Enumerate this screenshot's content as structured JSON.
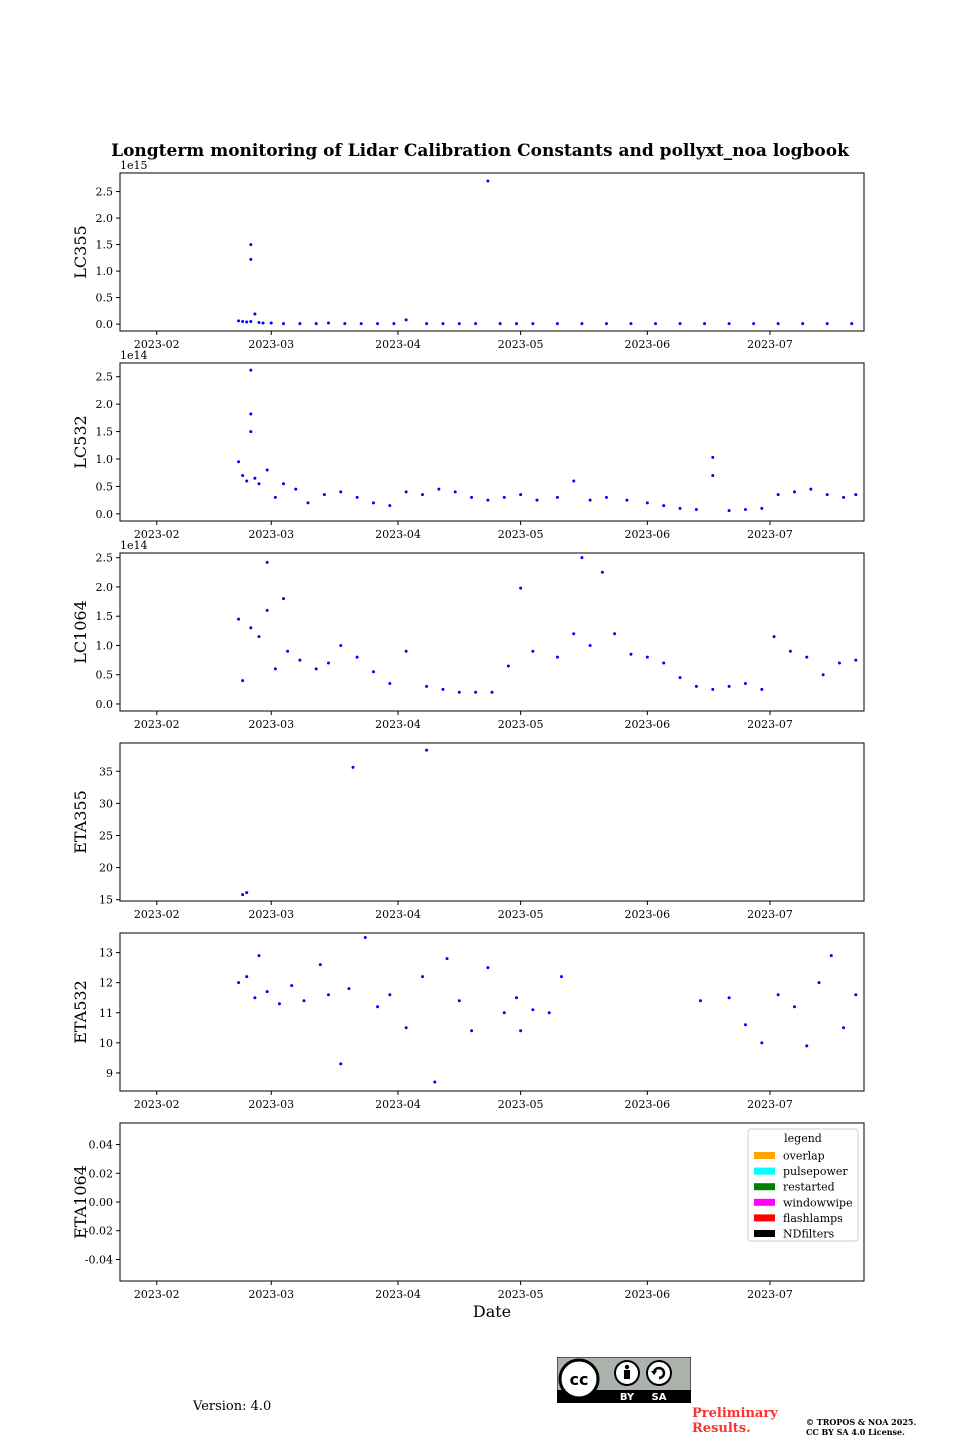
{
  "figure": {
    "title": "Longterm monitoring of Lidar Calibration Constants and pollyxt_noa logbook",
    "version": "Version: 4.0",
    "preliminary_line1": "Preliminary",
    "preliminary_line2": "Results.",
    "copyright_line1": "© TROPOS & NOA 2025.",
    "copyright_line2": "CC BY SA 4.0 License.",
    "license_badge": {
      "icons": [
        "cc-icon",
        "by-icon",
        "sa-icon"
      ],
      "by": "BY",
      "sa": "SA"
    }
  },
  "chart_data": [
    {
      "type": "scatter",
      "ylabel": "LC355",
      "xlabel": "",
      "offset_text": "1e15",
      "ylim": [
        -0.13,
        2.85
      ],
      "yticks": [
        0.0,
        0.5,
        1.0,
        1.5,
        2.0,
        2.5
      ],
      "ytick_decimals": 1,
      "xlim": [
        "2023-01-23",
        "2023-07-24"
      ],
      "xticks": [
        "2023-02",
        "2023-03",
        "2023-04",
        "2023-05",
        "2023-06",
        "2023-07"
      ],
      "xtick_dates": [
        "2023-02-01",
        "2023-03-01",
        "2023-04-01",
        "2023-05-01",
        "2023-06-01",
        "2023-07-01"
      ],
      "grid": false,
      "point_color": "#0000ff",
      "points": [
        [
          "2023-02-21",
          0.06
        ],
        [
          "2023-02-22",
          0.05
        ],
        [
          "2023-02-23",
          0.04
        ],
        [
          "2023-02-24",
          0.05
        ],
        [
          "2023-02-24",
          1.22
        ],
        [
          "2023-02-24",
          1.5
        ],
        [
          "2023-02-25",
          0.19
        ],
        [
          "2023-02-26",
          0.03
        ],
        [
          "2023-02-27",
          0.02
        ],
        [
          "2023-03-01",
          0.02
        ],
        [
          "2023-03-04",
          0.01
        ],
        [
          "2023-03-08",
          0.01
        ],
        [
          "2023-03-12",
          0.01
        ],
        [
          "2023-03-15",
          0.02
        ],
        [
          "2023-03-19",
          0.01
        ],
        [
          "2023-03-23",
          0.01
        ],
        [
          "2023-03-27",
          0.01
        ],
        [
          "2023-03-31",
          0.01
        ],
        [
          "2023-04-03",
          0.08
        ],
        [
          "2023-04-08",
          0.01
        ],
        [
          "2023-04-12",
          0.01
        ],
        [
          "2023-04-16",
          0.01
        ],
        [
          "2023-04-20",
          0.01
        ],
        [
          "2023-04-23",
          2.7
        ],
        [
          "2023-04-26",
          0.01
        ],
        [
          "2023-04-30",
          0.01
        ],
        [
          "2023-05-04",
          0.01
        ],
        [
          "2023-05-10",
          0.01
        ],
        [
          "2023-05-16",
          0.01
        ],
        [
          "2023-05-22",
          0.01
        ],
        [
          "2023-05-28",
          0.01
        ],
        [
          "2023-06-03",
          0.01
        ],
        [
          "2023-06-09",
          0.01
        ],
        [
          "2023-06-15",
          0.01
        ],
        [
          "2023-06-21",
          0.01
        ],
        [
          "2023-06-27",
          0.01
        ],
        [
          "2023-07-03",
          0.01
        ],
        [
          "2023-07-09",
          0.01
        ],
        [
          "2023-07-15",
          0.01
        ],
        [
          "2023-07-21",
          0.01
        ]
      ]
    },
    {
      "type": "scatter",
      "ylabel": "LC532",
      "xlabel": "",
      "offset_text": "1e14",
      "ylim": [
        -0.13,
        2.75
      ],
      "yticks": [
        0.0,
        0.5,
        1.0,
        1.5,
        2.0,
        2.5
      ],
      "ytick_decimals": 1,
      "xlim": [
        "2023-01-23",
        "2023-07-24"
      ],
      "xticks": [
        "2023-02",
        "2023-03",
        "2023-04",
        "2023-05",
        "2023-06",
        "2023-07"
      ],
      "xtick_dates": [
        "2023-02-01",
        "2023-03-01",
        "2023-04-01",
        "2023-05-01",
        "2023-06-01",
        "2023-07-01"
      ],
      "grid": false,
      "point_color": "#0000ff",
      "points": [
        [
          "2023-02-21",
          0.95
        ],
        [
          "2023-02-22",
          0.7
        ],
        [
          "2023-02-23",
          0.6
        ],
        [
          "2023-02-24",
          2.62
        ],
        [
          "2023-02-24",
          1.82
        ],
        [
          "2023-02-24",
          1.5
        ],
        [
          "2023-02-25",
          0.65
        ],
        [
          "2023-02-26",
          0.55
        ],
        [
          "2023-02-28",
          0.8
        ],
        [
          "2023-03-02",
          0.3
        ],
        [
          "2023-03-04",
          0.55
        ],
        [
          "2023-03-07",
          0.45
        ],
        [
          "2023-03-10",
          0.2
        ],
        [
          "2023-03-14",
          0.35
        ],
        [
          "2023-03-18",
          0.4
        ],
        [
          "2023-03-22",
          0.3
        ],
        [
          "2023-03-26",
          0.2
        ],
        [
          "2023-03-30",
          0.15
        ],
        [
          "2023-04-03",
          0.4
        ],
        [
          "2023-04-07",
          0.35
        ],
        [
          "2023-04-11",
          0.45
        ],
        [
          "2023-04-15",
          0.4
        ],
        [
          "2023-04-19",
          0.3
        ],
        [
          "2023-04-23",
          0.25
        ],
        [
          "2023-04-27",
          0.3
        ],
        [
          "2023-05-01",
          0.35
        ],
        [
          "2023-05-05",
          0.25
        ],
        [
          "2023-05-10",
          0.3
        ],
        [
          "2023-05-14",
          0.6
        ],
        [
          "2023-05-18",
          0.25
        ],
        [
          "2023-05-22",
          0.3
        ],
        [
          "2023-05-27",
          0.25
        ],
        [
          "2023-06-01",
          0.2
        ],
        [
          "2023-06-05",
          0.15
        ],
        [
          "2023-06-09",
          0.1
        ],
        [
          "2023-06-13",
          0.08
        ],
        [
          "2023-06-17",
          1.03
        ],
        [
          "2023-06-17",
          0.7
        ],
        [
          "2023-06-21",
          0.06
        ],
        [
          "2023-06-25",
          0.08
        ],
        [
          "2023-06-29",
          0.1
        ],
        [
          "2023-07-03",
          0.35
        ],
        [
          "2023-07-07",
          0.4
        ],
        [
          "2023-07-11",
          0.45
        ],
        [
          "2023-07-15",
          0.35
        ],
        [
          "2023-07-19",
          0.3
        ],
        [
          "2023-07-22",
          0.35
        ]
      ]
    },
    {
      "type": "scatter",
      "ylabel": "LC1064",
      "xlabel": "",
      "offset_text": "1e14",
      "ylim": [
        -0.12,
        2.58
      ],
      "yticks": [
        0.0,
        0.5,
        1.0,
        1.5,
        2.0,
        2.5
      ],
      "ytick_decimals": 1,
      "xlim": [
        "2023-01-23",
        "2023-07-24"
      ],
      "xticks": [
        "2023-02",
        "2023-03",
        "2023-04",
        "2023-05",
        "2023-06",
        "2023-07"
      ],
      "xtick_dates": [
        "2023-02-01",
        "2023-03-01",
        "2023-04-01",
        "2023-05-01",
        "2023-06-01",
        "2023-07-01"
      ],
      "grid": false,
      "point_color": "#0000ff",
      "points": [
        [
          "2023-02-21",
          1.45
        ],
        [
          "2023-02-22",
          0.4
        ],
        [
          "2023-02-24",
          1.3
        ],
        [
          "2023-02-26",
          1.15
        ],
        [
          "2023-02-28",
          1.6
        ],
        [
          "2023-02-28",
          2.42
        ],
        [
          "2023-03-02",
          0.6
        ],
        [
          "2023-03-04",
          1.8
        ],
        [
          "2023-03-05",
          0.9
        ],
        [
          "2023-03-08",
          0.75
        ],
        [
          "2023-03-12",
          0.6
        ],
        [
          "2023-03-15",
          0.7
        ],
        [
          "2023-03-18",
          1.0
        ],
        [
          "2023-03-22",
          0.8
        ],
        [
          "2023-03-26",
          0.55
        ],
        [
          "2023-03-30",
          0.35
        ],
        [
          "2023-04-03",
          0.9
        ],
        [
          "2023-04-08",
          0.3
        ],
        [
          "2023-04-12",
          0.25
        ],
        [
          "2023-04-16",
          0.2
        ],
        [
          "2023-04-20",
          0.2
        ],
        [
          "2023-04-24",
          0.2
        ],
        [
          "2023-04-28",
          0.65
        ],
        [
          "2023-05-01",
          1.98
        ],
        [
          "2023-05-04",
          0.9
        ],
        [
          "2023-05-10",
          0.8
        ],
        [
          "2023-05-14",
          1.2
        ],
        [
          "2023-05-16",
          2.5
        ],
        [
          "2023-05-18",
          1.0
        ],
        [
          "2023-05-21",
          2.25
        ],
        [
          "2023-05-24",
          1.2
        ],
        [
          "2023-05-28",
          0.85
        ],
        [
          "2023-06-01",
          0.8
        ],
        [
          "2023-06-05",
          0.7
        ],
        [
          "2023-06-09",
          0.45
        ],
        [
          "2023-06-13",
          0.3
        ],
        [
          "2023-06-17",
          0.25
        ],
        [
          "2023-06-21",
          0.3
        ],
        [
          "2023-06-25",
          0.35
        ],
        [
          "2023-06-29",
          0.25
        ],
        [
          "2023-07-02",
          1.15
        ],
        [
          "2023-07-06",
          0.9
        ],
        [
          "2023-07-10",
          0.8
        ],
        [
          "2023-07-14",
          0.5
        ],
        [
          "2023-07-18",
          0.7
        ],
        [
          "2023-07-22",
          0.75
        ]
      ]
    },
    {
      "type": "scatter",
      "ylabel": "ETA355",
      "xlabel": "",
      "offset_text": "",
      "ylim": [
        14.8,
        39.4
      ],
      "yticks": [
        15,
        20,
        25,
        30,
        35
      ],
      "ytick_decimals": 0,
      "xlim": [
        "2023-01-23",
        "2023-07-24"
      ],
      "xticks": [
        "2023-02",
        "2023-03",
        "2023-04",
        "2023-05",
        "2023-06",
        "2023-07"
      ],
      "xtick_dates": [
        "2023-02-01",
        "2023-03-01",
        "2023-04-01",
        "2023-05-01",
        "2023-06-01",
        "2023-07-01"
      ],
      "grid": false,
      "point_color": "#0000ff",
      "points": [
        [
          "2023-02-22",
          15.8
        ],
        [
          "2023-02-23",
          16.1
        ],
        [
          "2023-03-21",
          35.6
        ],
        [
          "2023-04-08",
          38.3
        ]
      ]
    },
    {
      "type": "scatter",
      "ylabel": "ETA532",
      "xlabel": "",
      "offset_text": "",
      "ylim": [
        8.4,
        13.65
      ],
      "yticks": [
        9,
        10,
        11,
        12,
        13
      ],
      "ytick_decimals": 0,
      "xlim": [
        "2023-01-23",
        "2023-07-24"
      ],
      "xticks": [
        "2023-02",
        "2023-03",
        "2023-04",
        "2023-05",
        "2023-06",
        "2023-07"
      ],
      "xtick_dates": [
        "2023-02-01",
        "2023-03-01",
        "2023-04-01",
        "2023-05-01",
        "2023-06-01",
        "2023-07-01"
      ],
      "grid": false,
      "point_color": "#0000ff",
      "points": [
        [
          "2023-02-21",
          12.0
        ],
        [
          "2023-02-23",
          12.2
        ],
        [
          "2023-02-25",
          11.5
        ],
        [
          "2023-02-26",
          12.9
        ],
        [
          "2023-02-28",
          11.7
        ],
        [
          "2023-03-03",
          11.3
        ],
        [
          "2023-03-06",
          11.9
        ],
        [
          "2023-03-09",
          11.4
        ],
        [
          "2023-03-13",
          12.6
        ],
        [
          "2023-03-15",
          11.6
        ],
        [
          "2023-03-18",
          9.3
        ],
        [
          "2023-03-20",
          11.8
        ],
        [
          "2023-03-24",
          13.5
        ],
        [
          "2023-03-27",
          11.2
        ],
        [
          "2023-03-30",
          11.6
        ],
        [
          "2023-04-03",
          10.5
        ],
        [
          "2023-04-07",
          12.2
        ],
        [
          "2023-04-10",
          8.7
        ],
        [
          "2023-04-13",
          12.8
        ],
        [
          "2023-04-16",
          11.4
        ],
        [
          "2023-04-19",
          10.4
        ],
        [
          "2023-04-23",
          12.5
        ],
        [
          "2023-04-27",
          11.0
        ],
        [
          "2023-04-30",
          11.5
        ],
        [
          "2023-05-01",
          10.4
        ],
        [
          "2023-05-04",
          11.1
        ],
        [
          "2023-05-08",
          11.0
        ],
        [
          "2023-05-11",
          12.2
        ],
        [
          "2023-06-14",
          11.4
        ],
        [
          "2023-06-21",
          11.5
        ],
        [
          "2023-06-25",
          10.6
        ],
        [
          "2023-06-29",
          10.0
        ],
        [
          "2023-07-03",
          11.6
        ],
        [
          "2023-07-07",
          11.2
        ],
        [
          "2023-07-10",
          9.9
        ],
        [
          "2023-07-13",
          12.0
        ],
        [
          "2023-07-16",
          12.9
        ],
        [
          "2023-07-19",
          10.5
        ],
        [
          "2023-07-22",
          11.6
        ]
      ]
    },
    {
      "type": "scatter",
      "ylabel": "ETA1064",
      "xlabel": "Date",
      "offset_text": "",
      "ylim": [
        -0.055,
        0.055
      ],
      "yticks": [
        -0.04,
        -0.02,
        0.0,
        0.02,
        0.04
      ],
      "ytick_decimals": 2,
      "xlim": [
        "2023-01-23",
        "2023-07-24"
      ],
      "xticks": [
        "2023-02",
        "2023-03",
        "2023-04",
        "2023-05",
        "2023-06",
        "2023-07"
      ],
      "xtick_dates": [
        "2023-02-01",
        "2023-03-01",
        "2023-04-01",
        "2023-05-01",
        "2023-06-01",
        "2023-07-01"
      ],
      "grid": false,
      "point_color": "#0000ff",
      "points": [],
      "legend": {
        "title": "legend",
        "placement": "top-right",
        "entries": [
          {
            "label": "overlap",
            "color": "#ffa500"
          },
          {
            "label": "pulsepower",
            "color": "#00ffff"
          },
          {
            "label": "restarted",
            "color": "#008000"
          },
          {
            "label": "windowwipe",
            "color": "#ff00ff"
          },
          {
            "label": "flashlamps",
            "color": "#ff0000"
          },
          {
            "label": "NDfilters",
            "color": "#000000"
          }
        ]
      }
    }
  ]
}
